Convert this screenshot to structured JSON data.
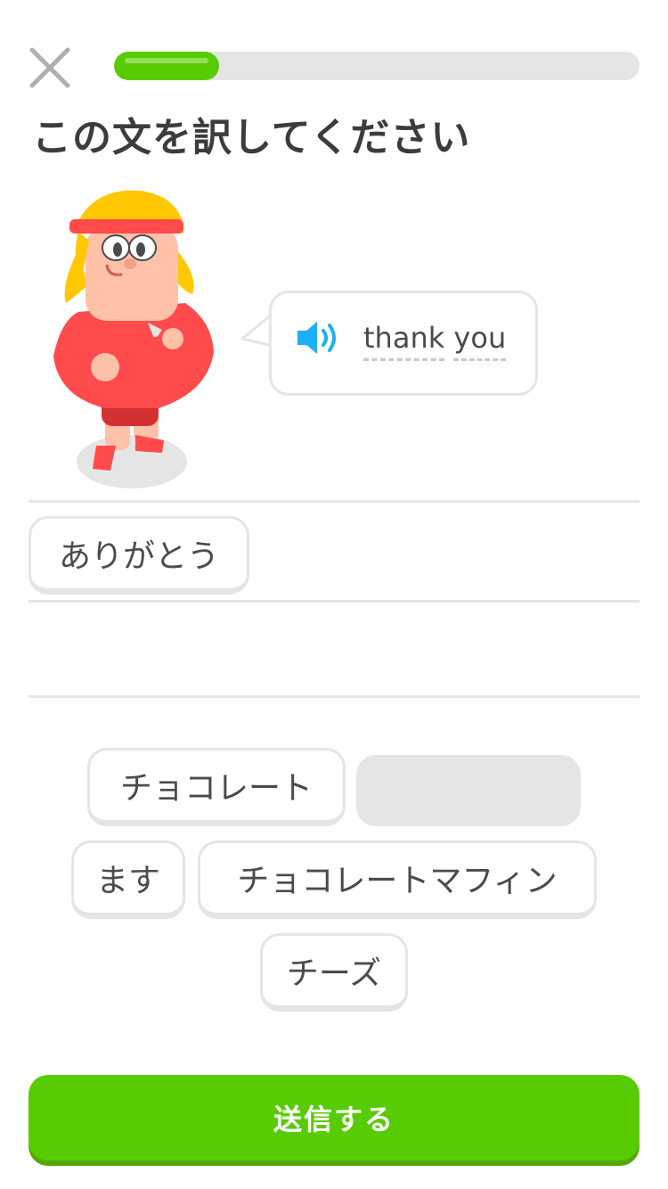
{
  "header": {
    "close_icon": "close-icon",
    "progress": {
      "value": 0.2,
      "color": "#58cc02"
    }
  },
  "prompt": {
    "title": "この文を訳してください"
  },
  "speech": {
    "icon": "speaker-icon",
    "words": [
      "thank",
      "you"
    ]
  },
  "answer": {
    "tiles": [
      "ありがとう"
    ]
  },
  "word_bank": {
    "tiles": [
      "チョコレート",
      "ます",
      "チョコレートマフィン",
      "チーズ"
    ]
  },
  "footer": {
    "submit_label": "送信する"
  },
  "colors": {
    "accent": "#58cc02",
    "accent_shadow": "#58a700",
    "border": "#e5e5e5",
    "speaker_blue": "#1cb0f6",
    "character_shirt": "#ff4b4b",
    "character_hair": "#ffc800"
  }
}
